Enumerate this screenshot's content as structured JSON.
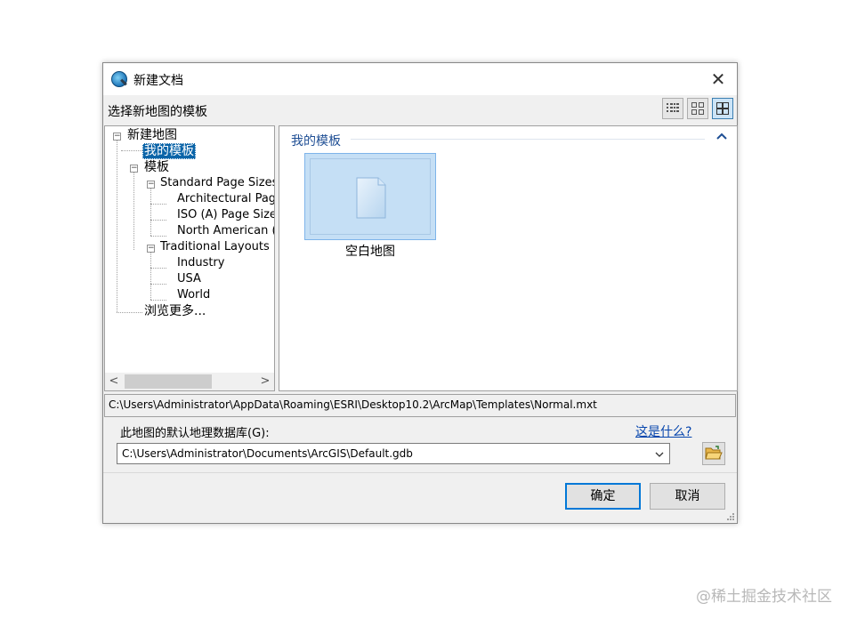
{
  "window": {
    "title": "新建文档",
    "close_glyph": "✕"
  },
  "header": {
    "label": "选择新地图的模板"
  },
  "view_buttons": [
    {
      "name": "list-view",
      "icon": "list-view-icon"
    },
    {
      "name": "small-icons-view",
      "icon": "small-icons-icon"
    },
    {
      "name": "large-icons-view",
      "icon": "large-icons-icon",
      "active": true
    }
  ],
  "tree": {
    "root": "新建地图",
    "my_templates": "我的模板",
    "templates": "模板",
    "standard_page_sizes": "Standard Page Sizes",
    "architectural": "Architectural Page",
    "iso": "ISO (A) Page Sizes",
    "north_american": "North American (A",
    "traditional_layouts": "Traditional Layouts",
    "industry": "Industry",
    "usa": "USA",
    "world": "World",
    "browse_more": "浏览更多...",
    "scroll_left": "<",
    "scroll_right": ">"
  },
  "main": {
    "group_title": "我的模板",
    "tile_label": "空白地图"
  },
  "path": "C:\\Users\\Administrator\\AppData\\Roaming\\ESRI\\Desktop10.2\\ArcMap\\Templates\\Normal.mxt",
  "gdb": {
    "label": "此地图的默认地理数据库(G):",
    "what_link": "这是什么?",
    "value": "C:\\Users\\Administrator\\Documents\\ArcGIS\\Default.gdb"
  },
  "buttons": {
    "ok": "确定",
    "cancel": "取消"
  },
  "watermark": "@稀土掘金技术社区",
  "colors": {
    "accent": "#0078d7",
    "selection": "#0a64a8",
    "tile": "#c5dff5",
    "link": "#0645ad"
  }
}
